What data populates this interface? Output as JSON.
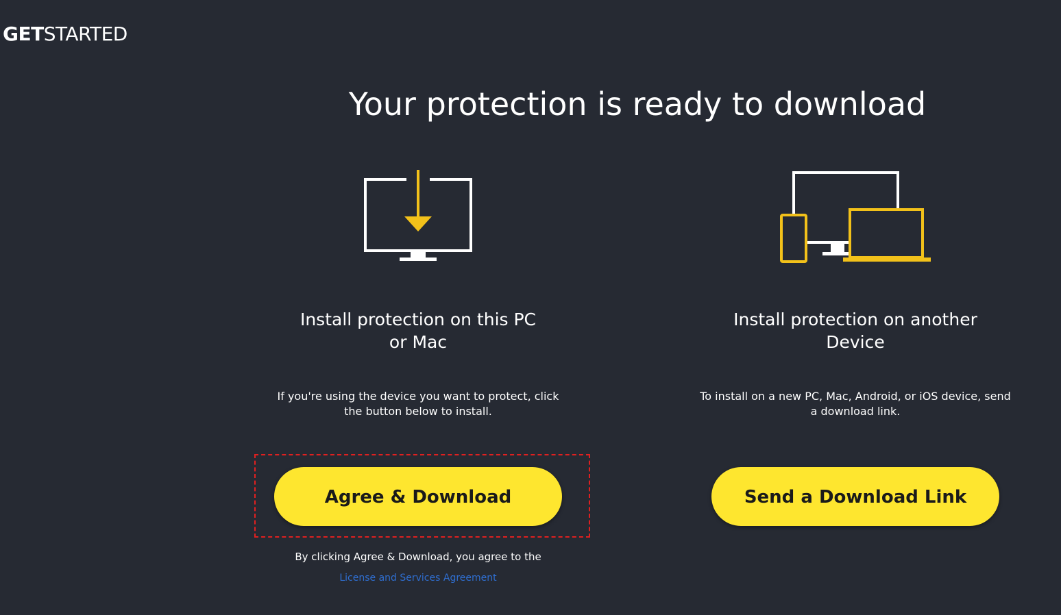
{
  "header": {
    "title_bold": "GET",
    "title_light": "STARTED"
  },
  "main": {
    "title": "Your protection is ready to download"
  },
  "options": {
    "this_device": {
      "icon": "monitor-download-icon",
      "title": "Install protection on this PC or Mac",
      "description": "If you're using the device you want to protect, click the button below to install.",
      "button_label": "Agree & Download"
    },
    "other_device": {
      "icon": "multi-device-icon",
      "title": "Install protection on another Device",
      "description": "To install on a new PC, Mac, Android, or iOS device, send a download link.",
      "button_label": "Send a Download Link"
    }
  },
  "legal": {
    "text": "By clicking Agree & Download, you agree to the",
    "link_text": "License and Services Agreement"
  },
  "colors": {
    "background": "#262a33",
    "accent_yellow": "#fee62f",
    "icon_yellow": "#f2c11a",
    "link_blue": "#2f6ed0",
    "highlight_red": "#e02020"
  }
}
